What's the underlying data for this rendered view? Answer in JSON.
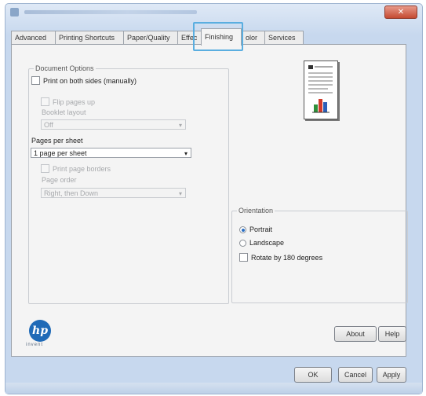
{
  "window": {
    "close_glyph": "✕"
  },
  "tabs": [
    {
      "label": "Advanced"
    },
    {
      "label": "Printing Shortcuts"
    },
    {
      "label": "Paper/Quality"
    },
    {
      "label": "Effec"
    },
    {
      "label": "Finishing",
      "active": true
    },
    {
      "label": "olor"
    },
    {
      "label": "Services"
    }
  ],
  "document_options": {
    "title": "Document Options",
    "print_both_sides": {
      "label": "Print on both sides (manually)",
      "checked": false
    },
    "flip_pages_up": {
      "label": "Flip pages up",
      "checked": false,
      "enabled": false
    },
    "booklet_layout_label": "Booklet layout",
    "booklet_layout_value": "Off",
    "pages_per_sheet_label": "Pages per sheet",
    "pages_per_sheet_value": "1 page per sheet",
    "print_page_borders": {
      "label": "Print page borders",
      "checked": false,
      "enabled": false
    },
    "page_order_label": "Page order",
    "page_order_value": "Right, then Down"
  },
  "orientation": {
    "title": "Orientation",
    "portrait_label": "Portrait",
    "landscape_label": "Landscape",
    "selected": "Portrait",
    "rotate_label": "Rotate by 180 degrees",
    "rotate_checked": false
  },
  "brand": {
    "tag": "invent"
  },
  "buttons": {
    "about": "About",
    "help": "Help",
    "ok": "OK",
    "cancel": "Cancel",
    "apply": "Apply"
  },
  "icons": {
    "hp_logo": "hp-logo-icon",
    "page_preview": "document-preview-icon",
    "dropdown": "chevron-down-icon",
    "close": "close-icon"
  },
  "colors": {
    "hp_blue": "#1f6ab7",
    "tab_highlight": "#5aaee0",
    "close_red": "#c44a32"
  }
}
